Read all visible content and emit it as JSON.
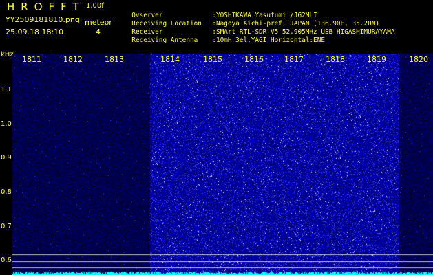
{
  "header": {
    "app_title": "HROFFT",
    "version": "1.00f",
    "filename": "YY2509181810.png",
    "timestamp": "25.09.18 18:10",
    "meteor_label": "meteor",
    "meteor_count": "4"
  },
  "station_info": [
    {
      "key": "Ovserver",
      "value": ":YOSHIKAWA Yasufumi /JG2MLI"
    },
    {
      "key": "Receiving Location",
      "value": ":Nagoya Aichi-pref. JAPAN (136.90E, 35.20N)"
    },
    {
      "key": "Receiver",
      "value": ":SMArt RTL-SDR V5 52.905MHz USB HIGASHIMURAYAMA"
    },
    {
      "key": "Receiving Antenna",
      "value": ":10mH 3el.YAGI Horizontal:ENE"
    }
  ],
  "spectrogram": {
    "y_unit": "kHz",
    "x_ticks": [
      "1811",
      "1812",
      "1813",
      "1814",
      "1815",
      "1816",
      "1817",
      "1818",
      "1819",
      "1820"
    ],
    "y_ticks": [
      "1.1",
      "1.0",
      "0.9",
      "0.8",
      "0.7",
      "0.6"
    ],
    "colors": {
      "background": "#000000",
      "label": "#ffff33",
      "noise": "#2a2aff",
      "grid": "#ffffff",
      "baseline": "#00ffff"
    }
  }
}
